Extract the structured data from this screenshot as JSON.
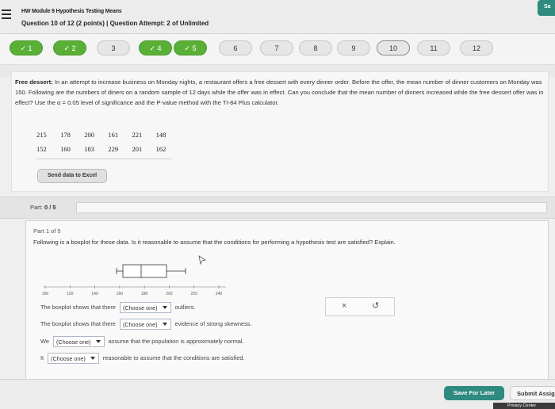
{
  "header": {
    "title": "HW Module 9 Hypothesis Testing Means",
    "subtitle": "Question 10 of 12 (2 points) | Question Attempt: 2 of Unlimited",
    "save_label": "Sa"
  },
  "question_nav": [
    {
      "label": "1",
      "status": "done"
    },
    {
      "label": "2",
      "status": "done"
    },
    {
      "label": "3",
      "status": "todo"
    },
    {
      "label": "4",
      "status": "done"
    },
    {
      "label": "5",
      "status": "done"
    },
    {
      "label": "6",
      "status": "todo"
    },
    {
      "label": "7",
      "status": "todo"
    },
    {
      "label": "8",
      "status": "todo"
    },
    {
      "label": "9",
      "status": "todo"
    },
    {
      "label": "10",
      "status": "current"
    },
    {
      "label": "11",
      "status": "todo"
    },
    {
      "label": "12",
      "status": "todo"
    }
  ],
  "question": {
    "lead": "Free dessert:",
    "text": "In an attempt to increase business on Monday nights, a restaurant offers a free dessert with every dinner order. Before the offer, the mean number of dinner customers on Monday was 150. Following are the numbers of diners on a random sample of 12 days while the offer was in effect. Can you conclude that the mean number of dinners increased while the free dessert offer was in effect? Use the α = 0.05 level of significance and the P-value method with the TI-84 Plus calculator.",
    "data_rows": [
      [
        "215",
        "178",
        "200",
        "161",
        "221",
        "148"
      ],
      [
        "152",
        "160",
        "183",
        "229",
        "201",
        "162"
      ]
    ],
    "send_excel_label": "Send data to Excel"
  },
  "part_bar": {
    "label": "Part:",
    "progress_text": "0 / 5"
  },
  "panel": {
    "part_title": "Part 1 of 5",
    "prompt": "Following is a boxplot for these data. Is it reasonable to assume that the conditions for performing a hypothesis test are satisfied? Explain.",
    "boxplot": {
      "axis_ticks": [
        "100",
        "120",
        "140",
        "160",
        "180",
        "200",
        "220",
        "240"
      ]
    },
    "answers": [
      {
        "before": "The boxplot shows that there",
        "select": "(Choose one)",
        "after": "outliers."
      },
      {
        "before": "The boxplot shows that there",
        "select": "(Choose one)",
        "after": "evidence of strong skewness."
      },
      {
        "before": "We",
        "select": "(Choose one)",
        "after": "assume that the population is approximately normal."
      },
      {
        "before": "It",
        "select": "(Choose one)",
        "after": "reasonable to assume that the conditions are satisfied."
      }
    ],
    "clear_icon": "×",
    "undo_icon": "↺"
  },
  "footer": {
    "save_later_label": "Save For Later",
    "submit_label": "Submit Assig",
    "privacy_label": "Privacy Center"
  }
}
